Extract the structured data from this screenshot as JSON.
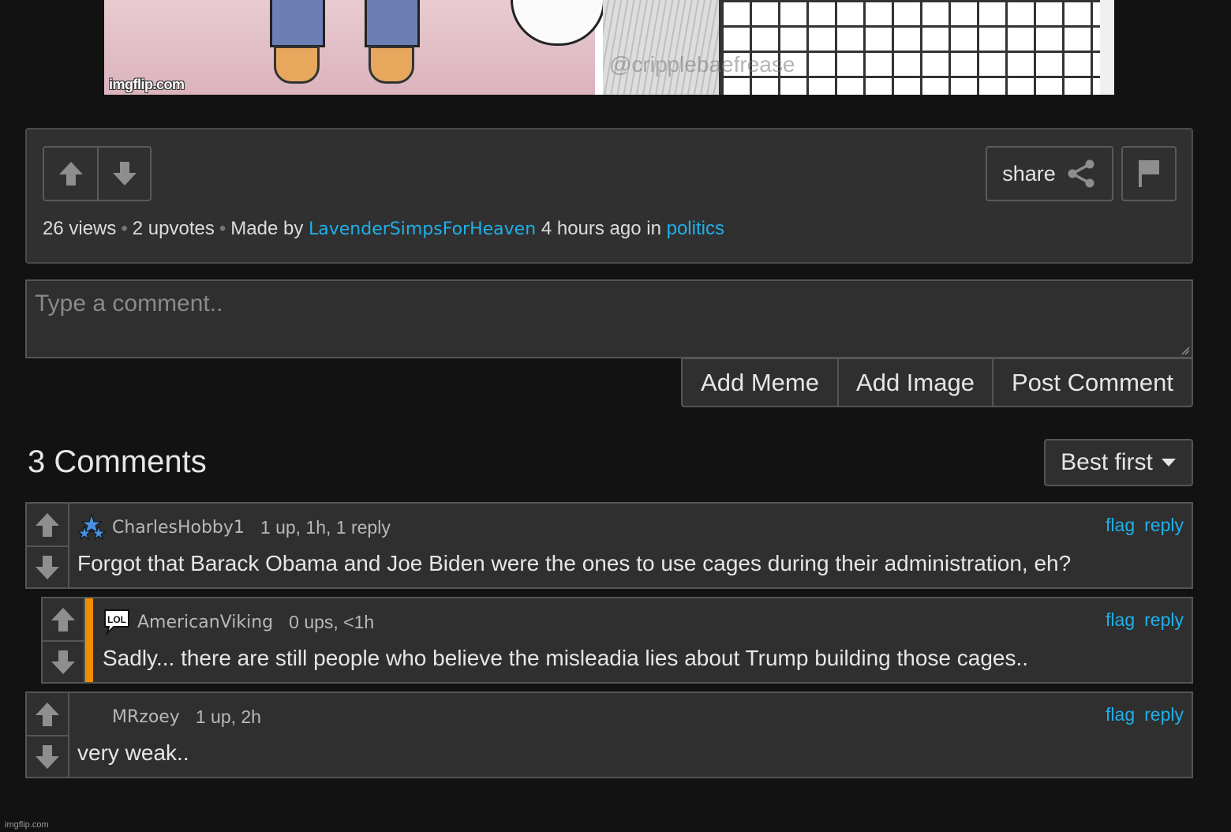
{
  "meme": {
    "watermark": "imgflip.com",
    "tiktok_handle": "@cripplebaefrease"
  },
  "post": {
    "share_label": "share",
    "views": "26 views",
    "upvotes": "2 upvotes",
    "made_by_prefix": "Made by",
    "author": "LavenderSimpsForHeaven",
    "time": "4 hours ago in",
    "stream": "politics"
  },
  "composer": {
    "placeholder": "Type a comment..",
    "add_meme": "Add Meme",
    "add_image": "Add Image",
    "post_comment": "Post Comment"
  },
  "comments_header": {
    "count_label": "3 Comments",
    "sort_label": "Best first"
  },
  "comments": [
    {
      "user": "CharlesHobby1",
      "stats": "1 up, 1h, 1 reply",
      "text": "Forgot that Barack Obama and Joe Biden were the ones to use cages during their administration, eh?",
      "flag": "flag",
      "reply": "reply",
      "badge": "stars-icon"
    },
    {
      "user": "AmericanViking",
      "stats": "0 ups, <1h",
      "text": "Sadly... there are still people who believe the misleadia lies about Trump building those cages..",
      "flag": "flag",
      "reply": "reply",
      "badge": "lol-icon",
      "badge_text": "LOL"
    },
    {
      "user": "MRzoey",
      "stats": "1 up, 2h",
      "text": "very weak..",
      "flag": "flag",
      "reply": "reply"
    }
  ],
  "footer": {
    "watermark": "imgflip.com"
  },
  "colors": {
    "background": "#121212",
    "panel": "#303030",
    "link": "#1fb0ea",
    "reply_bar": "#f08c00"
  }
}
